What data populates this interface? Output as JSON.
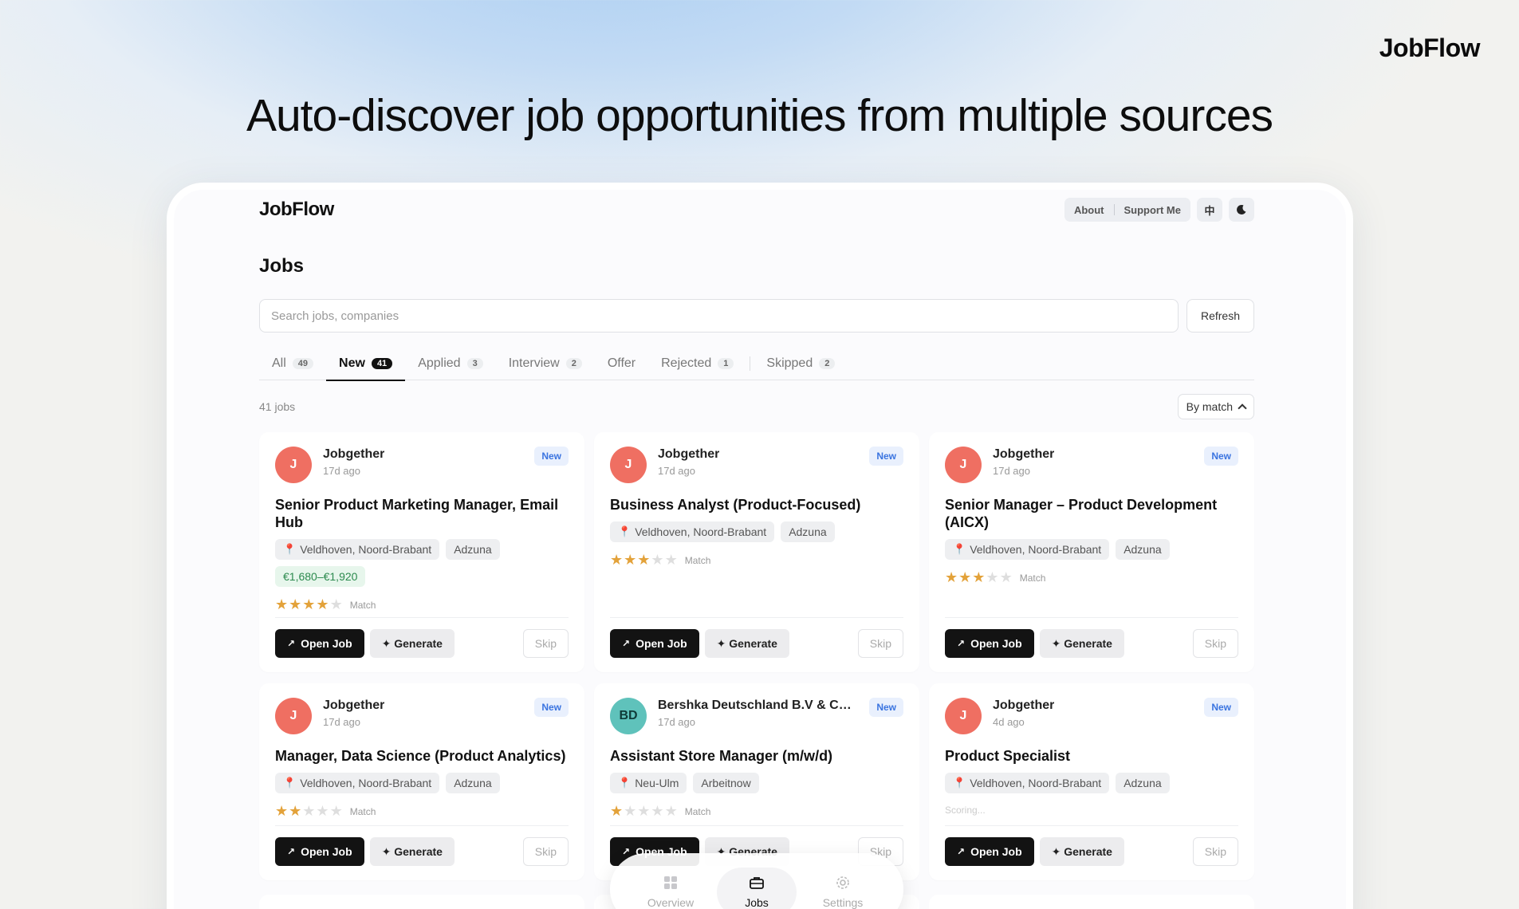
{
  "brand": "JobFlow",
  "hero_title": "Auto-discover job opportunities from multiple sources",
  "app": {
    "logo": "JobFlow",
    "top_actions": {
      "about": "About",
      "support": "Support Me",
      "lang_glyph": "中",
      "theme_icon": "moon-icon"
    },
    "page_title": "Jobs",
    "search_placeholder": "Search jobs, companies",
    "refresh_label": "Refresh",
    "tabs": [
      {
        "label": "All",
        "count": "49"
      },
      {
        "label": "New",
        "count": "41"
      },
      {
        "label": "Applied",
        "count": "3"
      },
      {
        "label": "Interview",
        "count": "2"
      },
      {
        "label": "Offer",
        "count": ""
      },
      {
        "label": "Rejected",
        "count": "1"
      },
      {
        "label": "Skipped",
        "count": "2"
      }
    ],
    "active_tab": "New",
    "jobs_count": "41 jobs",
    "sort_label": "By match",
    "actions": {
      "open": "Open Job",
      "generate": "✦ Generate",
      "skip": "Skip",
      "match": "Match"
    },
    "cards": [
      {
        "avatar": "J",
        "avatar_color": "#ef6f62",
        "company": "Jobgether",
        "posted": "17d ago",
        "badge": "New",
        "title": "Senior Product Marketing Manager, Email Hub",
        "location": "Veldhoven, Noord-Brabant",
        "source": "Adzuna",
        "salary": "€1,680–€1,920",
        "stars": 4
      },
      {
        "avatar": "J",
        "avatar_color": "#ef6f62",
        "company": "Jobgether",
        "posted": "17d ago",
        "badge": "New",
        "title": "Business Analyst (Product-Focused)",
        "location": "Veldhoven, Noord-Brabant",
        "source": "Adzuna",
        "salary": "",
        "stars": 3
      },
      {
        "avatar": "J",
        "avatar_color": "#ef6f62",
        "company": "Jobgether",
        "posted": "17d ago",
        "badge": "New",
        "title": "Senior Manager – Product Development (AICX)",
        "location": "Veldhoven, Noord-Brabant",
        "source": "Adzuna",
        "salary": "",
        "stars": 3
      },
      {
        "avatar": "J",
        "avatar_color": "#ef6f62",
        "company": "Jobgether",
        "posted": "17d ago",
        "badge": "New",
        "title": "Manager, Data Science (Product Analytics)",
        "location": "Veldhoven, Noord-Brabant",
        "source": "Adzuna",
        "salary": "",
        "stars": 2
      },
      {
        "avatar": "BD",
        "avatar_color": "#5fc2bb",
        "avatar_text_color": "#0f3b38",
        "company": "Bershka Deutschland B.V & Co. ...",
        "posted": "17d ago",
        "badge": "New",
        "title": "Assistant Store Manager (m/w/d)",
        "location": "Neu-Ulm",
        "source": "Arbeitnow",
        "salary": "",
        "stars": 1
      },
      {
        "avatar": "J",
        "avatar_color": "#ef6f62",
        "company": "Jobgether",
        "posted": "4d ago",
        "badge": "New",
        "title": "Product Specialist",
        "location": "Veldhoven, Noord-Brabant",
        "source": "Adzuna",
        "salary": "",
        "stars": null,
        "scoring": "Scoring..."
      }
    ],
    "bottom_nav": [
      {
        "label": "Overview",
        "icon": "grid-icon"
      },
      {
        "label": "Jobs",
        "icon": "briefcase-icon"
      },
      {
        "label": "Settings",
        "icon": "gear-icon"
      }
    ]
  }
}
